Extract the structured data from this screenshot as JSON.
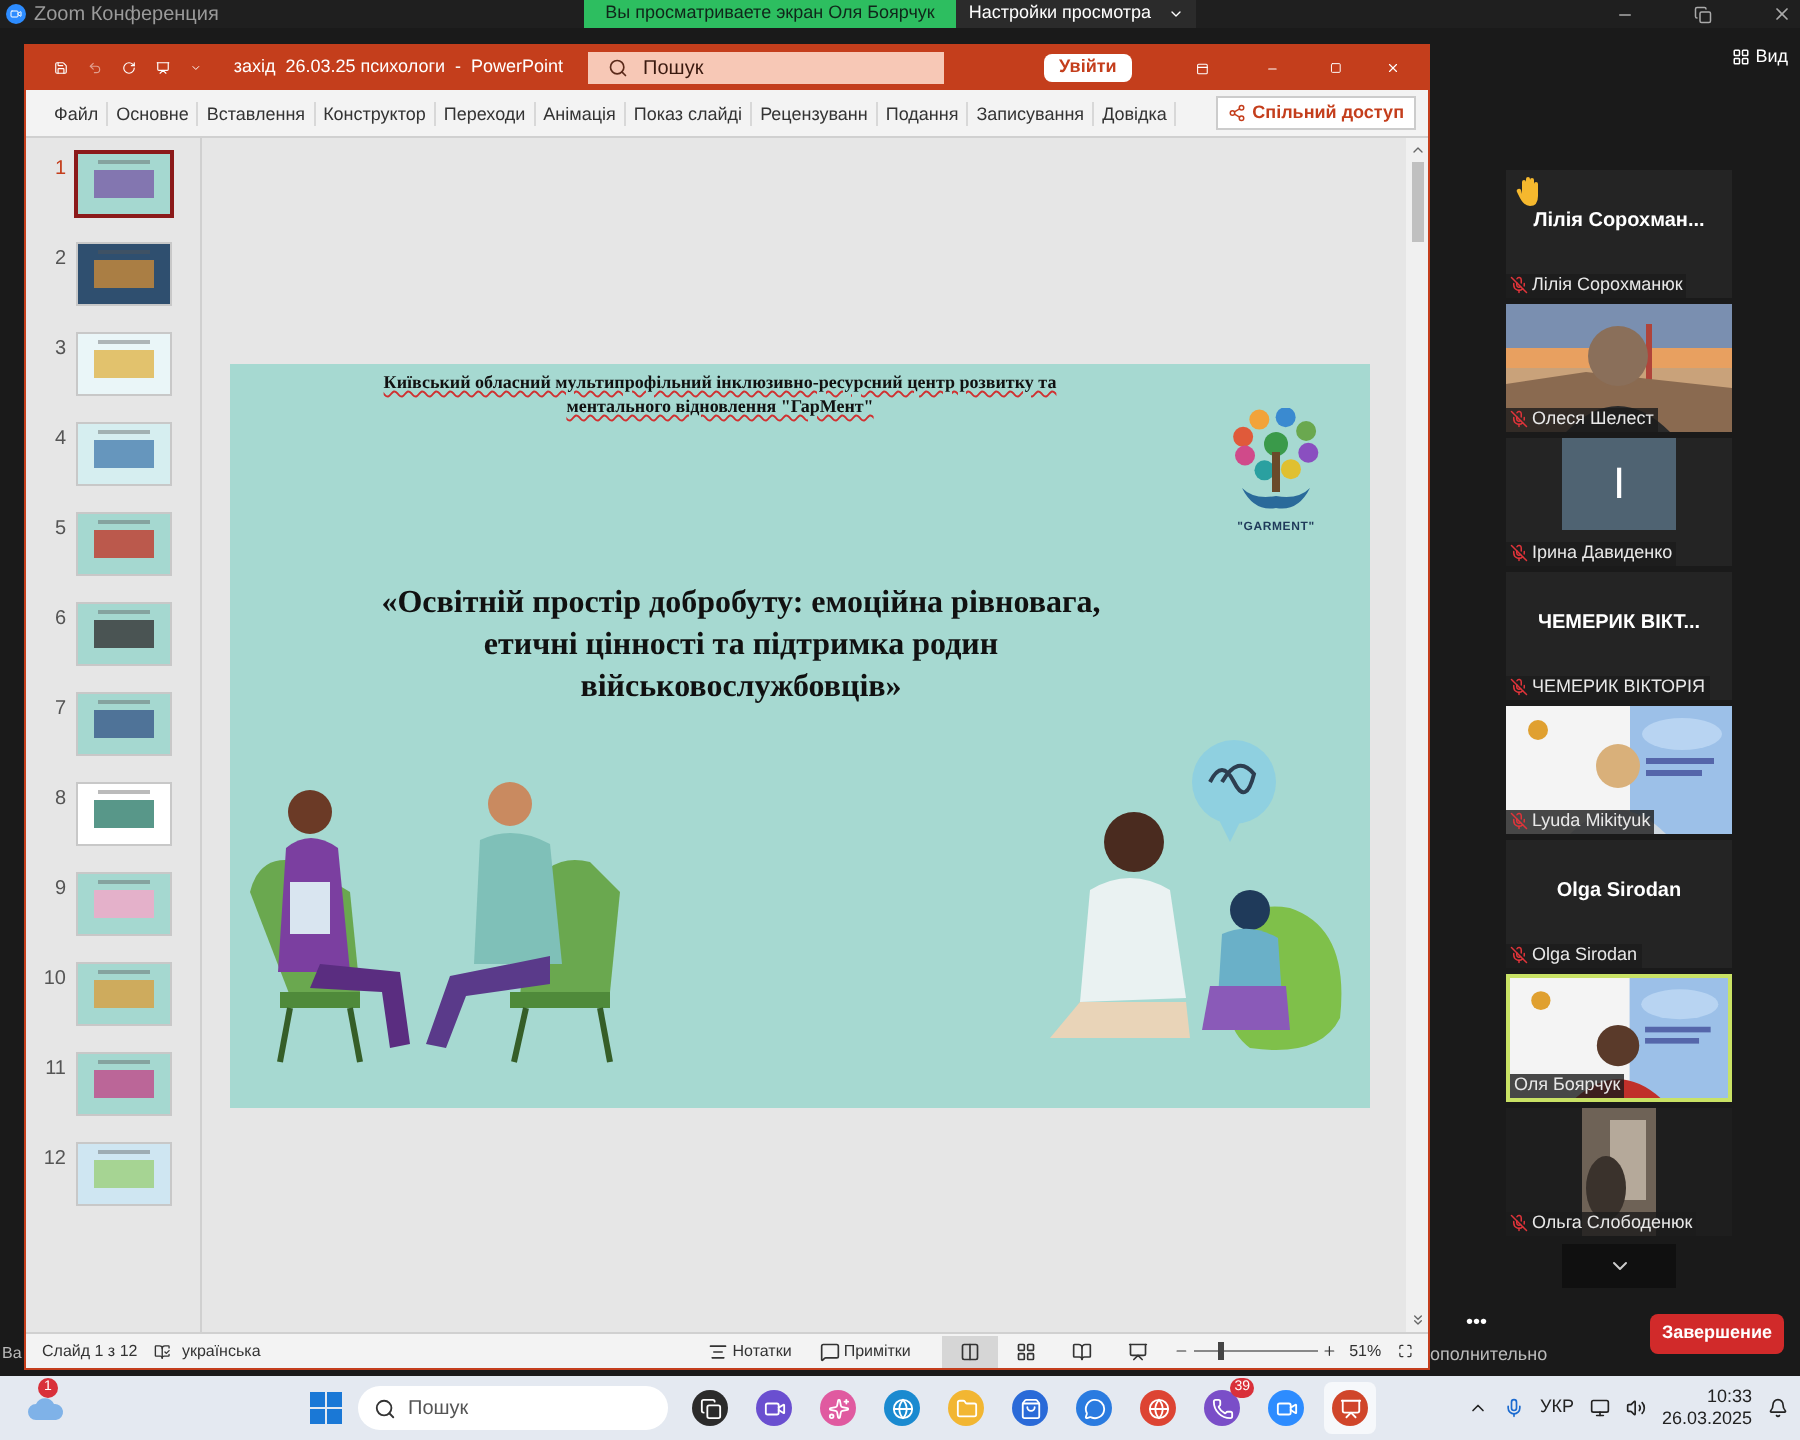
{
  "zoom_window": {
    "title": "Zoom Конференция",
    "share_banner": "Вы просматриваете экран Оля Боярчук",
    "view_options": "Настройки просмотра",
    "view_button": "Вид",
    "more": "•••",
    "end_button": "Завершение",
    "hidden_fragments": [
      "Ва",
      "ополнительно"
    ]
  },
  "powerpoint": {
    "file_title": "захід  26.03.25 психологи  -  PowerPoint",
    "search": {
      "placeholder": "Пошук"
    },
    "sign_in": "Увійти",
    "tabs": [
      "Файл",
      "Основне",
      "Вставлення",
      "Конструктор",
      "Переходи",
      "Анімація",
      "Показ слайді",
      "Рецензуванн",
      "Подання",
      "Записування",
      "Довідка"
    ],
    "share": "Спільний доступ",
    "slides": [
      {
        "number": "1",
        "selected": true
      },
      {
        "number": "2",
        "selected": false
      },
      {
        "number": "3",
        "selected": false
      },
      {
        "number": "4",
        "selected": false
      },
      {
        "number": "5",
        "selected": false
      },
      {
        "number": "6",
        "selected": false
      },
      {
        "number": "7",
        "selected": false
      },
      {
        "number": "8",
        "selected": false
      },
      {
        "number": "9",
        "selected": false
      },
      {
        "number": "10",
        "selected": false
      },
      {
        "number": "11",
        "selected": false
      },
      {
        "number": "12",
        "selected": false
      }
    ],
    "slide": {
      "header_lines": [
        "Київський обласний мультипрофільний інклюзивно-ресурсний центр розвитку та",
        "ментального відновлення \"ГарМент\""
      ],
      "logo_text": "\"GARMENT\"",
      "title_lines": [
        "«Освітній простір добробуту: емоційна рівновага,",
        "етичні цінності та підтримка родин",
        "військовослужбовців»"
      ]
    },
    "status": {
      "slide_count": "Слайд 1 з 12",
      "language": "українська",
      "notes": "Нотатки",
      "comments": "Примітки",
      "views": [
        {
          "selected": true
        },
        {
          "selected": false
        },
        {
          "selected": false
        },
        {
          "selected": false
        }
      ],
      "zoom": {
        "level": 0.2
      },
      "zoom_reading": "51%"
    }
  },
  "participants": [
    {
      "kind": "name",
      "display": "Лілія  Сорохман...",
      "name": "Лілія Сорохманюк",
      "muted": true,
      "hand_raised": true,
      "selected": false
    },
    {
      "kind": "video",
      "name": "Олеся Шелест",
      "muted": true,
      "hand_raised": false,
      "selected": false
    },
    {
      "kind": "avatar",
      "initial": "І",
      "name": "Ірина Давиденко",
      "muted": true,
      "hand_raised": false,
      "selected": false
    },
    {
      "kind": "name",
      "display": "ЧЕМЕРИК  ВІКТ...",
      "name": "ЧЕМЕРИК ВІКТОРІЯ",
      "muted": true,
      "hand_raised": false,
      "selected": false
    },
    {
      "kind": "video",
      "name": "Lyuda Mikityuk",
      "muted": true,
      "hand_raised": false,
      "selected": false
    },
    {
      "kind": "name",
      "display": "Olga Sirodan",
      "name": "Olga Sirodan",
      "muted": true,
      "hand_raised": false,
      "selected": false
    },
    {
      "kind": "video",
      "name": "Оля Боярчук",
      "muted": false,
      "hand_raised": false,
      "selected": true
    },
    {
      "kind": "video",
      "name": "Ольга Слободенюк",
      "muted": true,
      "hand_raised": false,
      "selected": false
    }
  ],
  "taskbar": {
    "weather_badge": "1",
    "search": {
      "placeholder": "Пошук"
    },
    "apps": [
      {
        "kind": "taskview"
      },
      {
        "kind": "meet"
      },
      {
        "kind": "copilot"
      },
      {
        "kind": "edge"
      },
      {
        "kind": "files"
      },
      {
        "kind": "store"
      },
      {
        "kind": "chat"
      },
      {
        "kind": "chrome"
      },
      {
        "kind": "viber",
        "badge": "39"
      },
      {
        "kind": "zoom"
      },
      {
        "kind": "powerpoint"
      }
    ],
    "language": "УКР",
    "time": "10:33",
    "date": "26.03.2025"
  }
}
